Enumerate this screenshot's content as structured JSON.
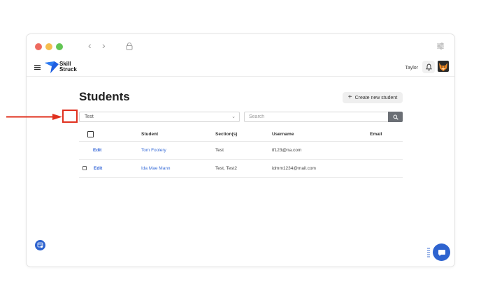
{
  "app": {
    "logo_line1": "Skill",
    "logo_line2": "Struck",
    "user_name": "Taylor"
  },
  "page": {
    "title": "Students",
    "create_button": "Create new student",
    "section_filter": "Test",
    "search_placeholder": "Search"
  },
  "table": {
    "headers": {
      "student": "Student",
      "sections": "Section(s)",
      "username": "Username",
      "email": "Email"
    },
    "rows": [
      {
        "action": "Edit",
        "student": "Tom Foolery",
        "sections": "Test",
        "username": "tf123@na.com",
        "email": ""
      },
      {
        "action": "Edit",
        "student": "Ida Mae Mann",
        "sections": "Test, Test2",
        "username": "idmm1234@mail.com",
        "email": ""
      }
    ]
  },
  "colors": {
    "accent": "#2e63cf",
    "annotation": "#e0301e"
  },
  "icons": {
    "window_close": "close-dot",
    "window_minimize": "minimize-dot",
    "window_zoom": "zoom-dot",
    "back": "chevron-left-icon",
    "forward": "chevron-right-icon",
    "lock": "lock-icon",
    "window_menu": "sliders-icon",
    "menu": "hamburger-icon",
    "logo": "skillstruck-logo",
    "notifications": "bell-icon",
    "avatar": "fox-avatar",
    "create": "plus-icon",
    "dropdown": "chevron-down-icon",
    "search": "search-icon",
    "accessibility": "accessibility-icon",
    "grip": "drag-grip-icon",
    "chat": "chat-icon"
  }
}
